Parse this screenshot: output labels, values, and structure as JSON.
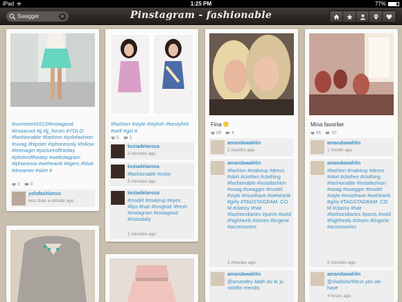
{
  "status_bar": {
    "device": "iPad",
    "time": "1:25 PM",
    "battery": "77%",
    "battery_level": 0.77
  },
  "header": {
    "title": "Pinstagram - fashionable",
    "search": {
      "value": "Swagger"
    },
    "nav_icons": [
      "home-icon",
      "star-icon",
      "user-icon",
      "location-icon",
      "heart-icon"
    ]
  },
  "cards": {
    "c1": {
      "caption": "#summer#2012#instagood #instacool #jj #jj_forum #YOLO #fashionable #fashion #yolofashion #swag #hipster #iphoneonly #follow #teenager #pictureoftheday #photooftheday #webstagram #iphonesia #weheartit #tigers #blue #dreamer #skirt #",
      "likes": "0",
      "comments": "0",
      "user": "yolofashionxx",
      "time": "less than a minute ago"
    },
    "c2": {
      "caption": "#fashion #style #stylish #bestylish #self #girl #",
      "likes": "5",
      "comments": "2",
      "comments_list": [
        {
          "user": "keziadelarosa",
          "text": "",
          "time": "3 minutes ago"
        },
        {
          "user": "keziadelarosa",
          "text": "#fashionable #color",
          "time": "3 minutes ago"
        },
        {
          "user": "keziadelarosa",
          "text": "#model #makeup #eyes #lips #hair #longhair #fresh #instagram #instagood #instadaily",
          "time": "2 minutes ago"
        }
      ]
    },
    "c3": {
      "caption": "Fina",
      "likes": "88",
      "comments": "4",
      "comments_list": [
        {
          "user": "amandawahlin",
          "text": "",
          "time": "2 months ago"
        },
        {
          "user": "amandawahlin",
          "text": "#fashion #makeup #dress #skirt #clothes #clothing #fashionable #instafashion #swag #swagger #model #style #musthave #weheartit #girly #TAGSTAGRAM .CO M #classy #hair #fashiondiaries #pants #ootd #highheels #shoes #lingerie #accessories",
          "time": "2 minutes ago"
        },
        {
          "user": "amandawahlin",
          "text": "@amandey äääh du är ju störtfin mendis",
          "time": ""
        }
      ]
    },
    "c4": {
      "caption": "Mina favoriter",
      "likes": "85",
      "comments": "10",
      "comments_list": [
        {
          "user": "amandawahlin",
          "text": "",
          "time": "1 month ago"
        },
        {
          "user": "amandawahlin",
          "text": "#fashion #makeup #dress #skirt #clothes #clothing #fashionable #instafashion #swag #swagger #model #style #musthave #weheartit #girly #TAGSTAGRAM .CO M #classy #hair #fashiondiaries #pants #ootd #highheels #shoes #lingerie #accessories",
          "time": "2 minutes ago"
        },
        {
          "user": "amandawahlin",
          "text": "@vladislav90rus yes we have",
          "time": "4 hours ago"
        }
      ]
    }
  },
  "colors": {
    "link": "#3a8fc4",
    "nav_dark": "#2a2826",
    "board_bg": "#c9bfaf"
  }
}
